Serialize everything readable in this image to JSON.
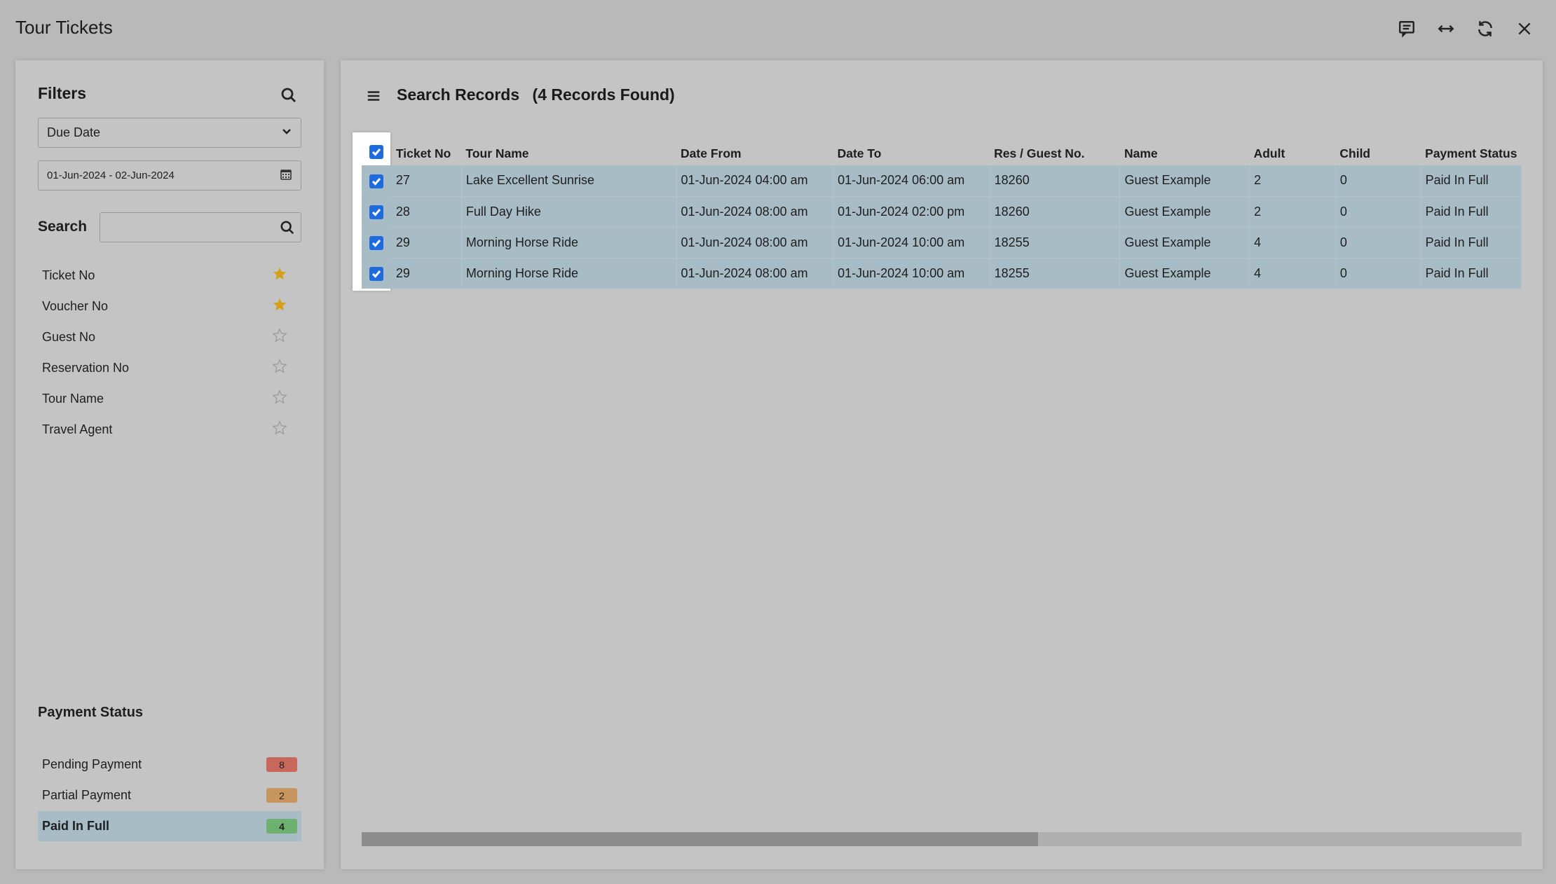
{
  "window": {
    "title": "Tour Tickets",
    "controls": [
      "comment-icon",
      "expand-horizontal-icon",
      "refresh-icon",
      "close-icon"
    ]
  },
  "filters": {
    "heading": "Filters",
    "date_type_selected": "Due Date",
    "date_range": "01-Jun-2024 - 02-Jun-2024",
    "search_label": "Search",
    "search_value": "",
    "fields": [
      {
        "label": "Ticket No",
        "starred": true
      },
      {
        "label": "Voucher No",
        "starred": true
      },
      {
        "label": "Guest No",
        "starred": false
      },
      {
        "label": "Reservation No",
        "starred": false
      },
      {
        "label": "Tour Name",
        "starred": false
      },
      {
        "label": "Travel Agent",
        "starred": false
      }
    ],
    "payment_status_heading": "Payment Status",
    "payment_statuses": [
      {
        "label": "Pending Payment",
        "count": "8",
        "color": "#c8675c",
        "active": false
      },
      {
        "label": "Partial Payment",
        "count": "2",
        "color": "#c7955e",
        "active": false
      },
      {
        "label": "Paid In Full",
        "count": "4",
        "color": "#6eb070",
        "active": true
      }
    ]
  },
  "records": {
    "title": "Search Records",
    "count_text": "(4 Records Found)",
    "columns": [
      "Ticket No",
      "Tour Name",
      "Date From",
      "Date To",
      "Res / Guest No.",
      "Name",
      "Adult",
      "Child",
      "Payment Status"
    ],
    "rows": [
      [
        "27",
        "Lake Excellent Sunrise",
        "01-Jun-2024 04:00 am",
        "01-Jun-2024 06:00 am",
        "18260",
        "Guest Example",
        "2",
        "0",
        "Paid In Full"
      ],
      [
        "28",
        "Full Day Hike",
        "01-Jun-2024 08:00 am",
        "01-Jun-2024 02:00 pm",
        "18260",
        "Guest Example",
        "2",
        "0",
        "Paid In Full"
      ],
      [
        "29",
        "Morning Horse Ride",
        "01-Jun-2024 08:00 am",
        "01-Jun-2024 10:00 am",
        "18255",
        "Guest Example",
        "4",
        "0",
        "Paid In Full"
      ],
      [
        "29",
        "Morning Horse Ride",
        "01-Jun-2024 08:00 am",
        "01-Jun-2024 10:00 am",
        "18255",
        "Guest Example",
        "4",
        "0",
        "Paid In Full"
      ]
    ],
    "all_selected": true,
    "row_selected": [
      true,
      true,
      true,
      true
    ]
  },
  "colors": {
    "accent": "#1e6be0",
    "star_active": "#d4a017",
    "row_highlight": "#a8bcc6"
  }
}
